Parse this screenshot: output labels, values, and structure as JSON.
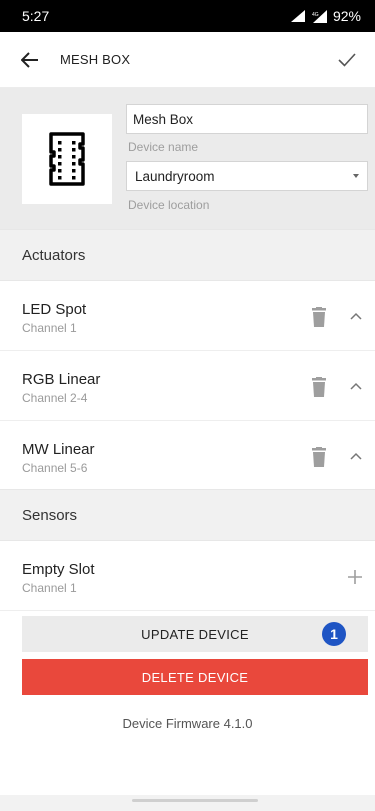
{
  "status_bar": {
    "time": "5:27",
    "battery": "92%",
    "network": "4G"
  },
  "header": {
    "title": "MESH BOX",
    "back_icon": "arrow-left-icon",
    "confirm_icon": "check-icon"
  },
  "device": {
    "image_icon": "mesh-box-device-icon",
    "name_value": "Mesh Box",
    "name_label": "Device name",
    "location_value": "Laundryroom",
    "location_label": "Device location"
  },
  "actuators": {
    "header": "Actuators",
    "items": [
      {
        "title": "LED Spot",
        "channel": "Channel 1"
      },
      {
        "title": "RGB Linear",
        "channel": "Channel 2-4"
      },
      {
        "title": "MW Linear",
        "channel": "Channel 5-6"
      }
    ]
  },
  "sensors": {
    "header": "Sensors",
    "items": [
      {
        "title": "Empty Slot",
        "channel": "Channel 1"
      }
    ]
  },
  "actions": {
    "update_label": "UPDATE DEVICE",
    "update_badge": "1",
    "delete_label": "DELETE DEVICE"
  },
  "footer": {
    "firmware": "Device Firmware 4.1.0"
  },
  "colors": {
    "delete": "#e9483c",
    "badge": "#1f55c4",
    "panel": "#ebebeb"
  }
}
